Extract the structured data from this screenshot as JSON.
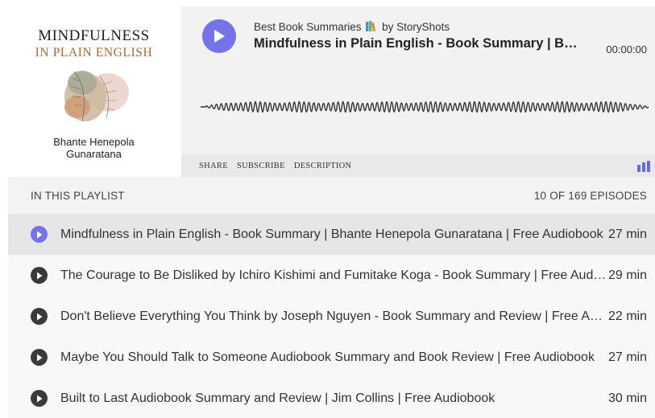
{
  "cover": {
    "title_line1": "MINDFULNESS",
    "title_line2": "IN PLAIN ENGLISH",
    "author_line1": "Bhante Henepola",
    "author_line2": "Gunaratana",
    "art": "abstract-leaf-illustration"
  },
  "player": {
    "podcast_name_before": "Best Book Summaries",
    "podcast_name_after": "by StoryShots",
    "books_icon": "books-emoji",
    "episode_title": "Mindfulness in Plain English - Book Summary | Bhante Henepola Gunaratana | Free Audiobook",
    "time": "00:00:00",
    "accent_color": "#7474e8",
    "links": {
      "share": "SHARE",
      "subscribe": "SUBSCRIBE",
      "description": "DESCRIPTION"
    }
  },
  "playlist": {
    "header_label": "IN THIS PLAYLIST",
    "episode_count": "10 OF 169 EPISODES",
    "items": [
      {
        "title": "Mindfulness in Plain English - Book Summary | Bhante Henepola Gunaratana | Free Audiobook",
        "duration": "27 min",
        "active": true
      },
      {
        "title": "The Courage to Be Disliked by Ichiro Kishimi and Fumitake Koga - Book Summary | Free Audiobook",
        "duration": "29 min",
        "active": false
      },
      {
        "title": "Don't Believe Everything You Think by Joseph Nguyen - Book Summary and Review | Free Audiobook",
        "duration": "22 min",
        "active": false
      },
      {
        "title": "Maybe You Should Talk to Someone Audiobook Summary and Book Review | Free Audiobook",
        "duration": "27 min",
        "active": false
      },
      {
        "title": "Built to Last Audiobook Summary and Review | Jim Collins | Free Audiobook",
        "duration": "30 min",
        "active": false
      }
    ]
  }
}
